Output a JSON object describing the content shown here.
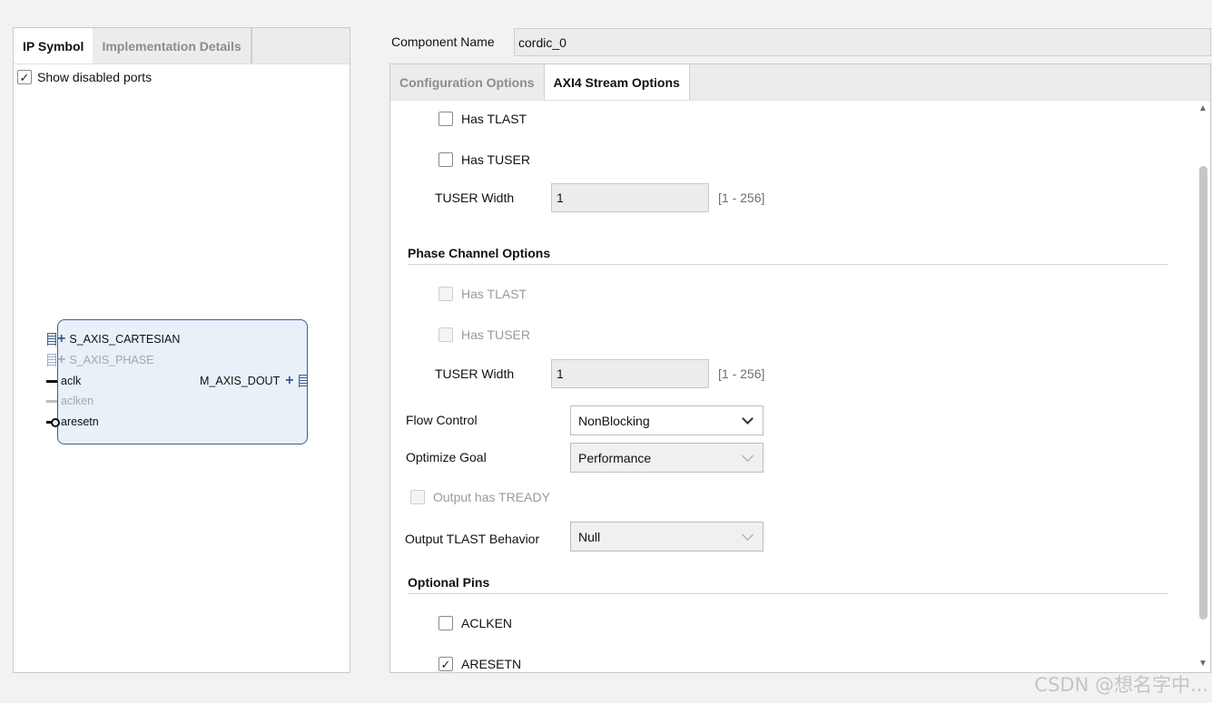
{
  "left": {
    "tabs": [
      "IP Symbol",
      "Implementation Details"
    ],
    "show_disabled_ports": {
      "label": "Show disabled ports",
      "checked": true
    },
    "ip_symbol": {
      "inputs": [
        {
          "name": "S_AXIS_CARTESIAN",
          "kind": "bus",
          "disabled": false
        },
        {
          "name": "S_AXIS_PHASE",
          "kind": "bus",
          "disabled": true
        },
        {
          "name": "aclk",
          "kind": "pin",
          "disabled": false
        },
        {
          "name": "aclken",
          "kind": "pin",
          "disabled": true
        },
        {
          "name": "aresetn",
          "kind": "pin-negated",
          "disabled": false
        }
      ],
      "outputs": [
        {
          "name": "M_AXIS_DOUT",
          "kind": "bus",
          "disabled": false
        }
      ]
    }
  },
  "component": {
    "label": "Component Name",
    "value": "cordic_0"
  },
  "right": {
    "tabs": [
      "Configuration Options",
      "AXI4 Stream Options"
    ],
    "cartesian": {
      "has_tlast": {
        "label": "Has TLAST",
        "checked": false
      },
      "has_tuser": {
        "label": "Has TUSER",
        "checked": false
      },
      "tuser_width": {
        "label": "TUSER Width",
        "value": "1",
        "range": "[1 - 256]"
      }
    },
    "phase": {
      "title": "Phase Channel Options",
      "has_tlast": {
        "label": "Has TLAST",
        "checked": false,
        "disabled": true
      },
      "has_tuser": {
        "label": "Has TUSER",
        "checked": false,
        "disabled": true
      },
      "tuser_width": {
        "label": "TUSER Width",
        "value": "1",
        "range": "[1 - 256]"
      }
    },
    "flow_control": {
      "label": "Flow Control",
      "value": "NonBlocking"
    },
    "optimize_goal": {
      "label": "Optimize Goal",
      "value": "Performance"
    },
    "output_tready": {
      "label": "Output has TREADY",
      "checked": false,
      "disabled": true
    },
    "output_tlast": {
      "label": "Output TLAST Behavior",
      "value": "Null"
    },
    "optional_pins": {
      "title": "Optional Pins",
      "aclken": {
        "label": "ACLKEN",
        "checked": false
      },
      "aresetn": {
        "label": "ARESETN",
        "checked": true
      }
    }
  },
  "watermark": "CSDN @想名字中..."
}
